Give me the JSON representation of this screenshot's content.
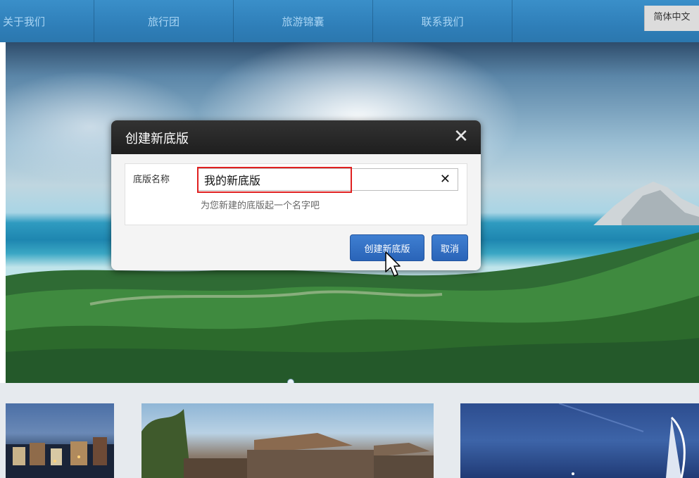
{
  "nav": {
    "items": [
      "关于我们",
      "旅行团",
      "旅游锦囊",
      "联系我们"
    ],
    "language": "简体中文"
  },
  "dialog": {
    "title": "创建新底版",
    "field_label": "底版名称",
    "input_value": "我的新底版",
    "hint": "为您新建的底版起一个名字吧",
    "create_label": "创建新底版",
    "cancel_label": "取消",
    "close_icon": "close-icon",
    "clear_icon": "clear-icon"
  },
  "colors": {
    "nav_bg": "#2f7fb9",
    "dialog_header": "#262626",
    "button_blue": "#2f6ec4",
    "highlight_red": "#e02020"
  }
}
